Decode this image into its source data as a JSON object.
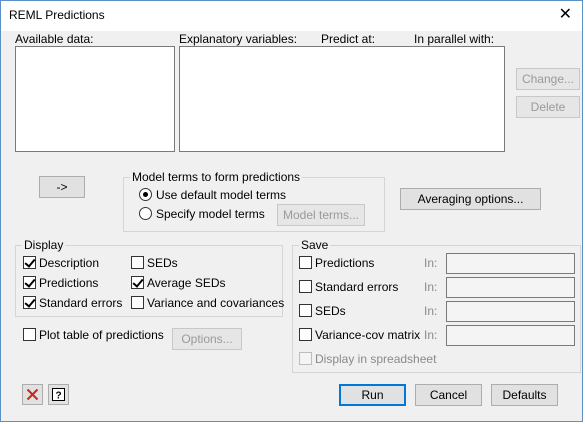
{
  "window": {
    "title": "REML Predictions",
    "close_glyph": "✕"
  },
  "labels": {
    "available_data": "Available data:",
    "explanatory_variables": "Explanatory variables:",
    "predict_at": "Predict at:",
    "in_parallel_with": "In parallel with:"
  },
  "buttons": {
    "change": "Change...",
    "delete": "Delete",
    "arrow": "->",
    "model_terms": "Model terms...",
    "averaging_options": "Averaging options...",
    "options": "Options...",
    "run": "Run",
    "cancel": "Cancel",
    "defaults": "Defaults"
  },
  "model_terms_group": {
    "title": "Model terms to form predictions",
    "options": [
      "Use default model terms",
      "Specify model terms"
    ],
    "selected": "Use default model terms"
  },
  "display_group": {
    "title": "Display",
    "items": [
      {
        "label": "Description",
        "checked": true
      },
      {
        "label": "Predictions",
        "checked": true
      },
      {
        "label": "Standard errors",
        "checked": true
      },
      {
        "label": "SEDs",
        "checked": false
      },
      {
        "label": "Average SEDs",
        "checked": true
      },
      {
        "label": "Variance and covariances",
        "checked": false
      }
    ]
  },
  "plot_table": {
    "label": "Plot table of predictions",
    "checked": false
  },
  "save_group": {
    "title": "Save",
    "in_label": "In:",
    "items": [
      {
        "label": "Predictions",
        "checked": false,
        "value": ""
      },
      {
        "label": "Standard errors",
        "checked": false,
        "value": ""
      },
      {
        "label": "SEDs",
        "checked": false,
        "value": ""
      },
      {
        "label": "Variance-cov matrix",
        "checked": false,
        "value": ""
      }
    ],
    "display_in_spreadsheet": {
      "label": "Display in spreadsheet",
      "checked": false,
      "disabled": true
    }
  },
  "icons": {
    "clear": "clear-icon",
    "help": "help-icon"
  },
  "colors": {
    "accent": "#0078d7",
    "clear_red": "#c42b1c",
    "window_border": "#5a8fc7"
  }
}
